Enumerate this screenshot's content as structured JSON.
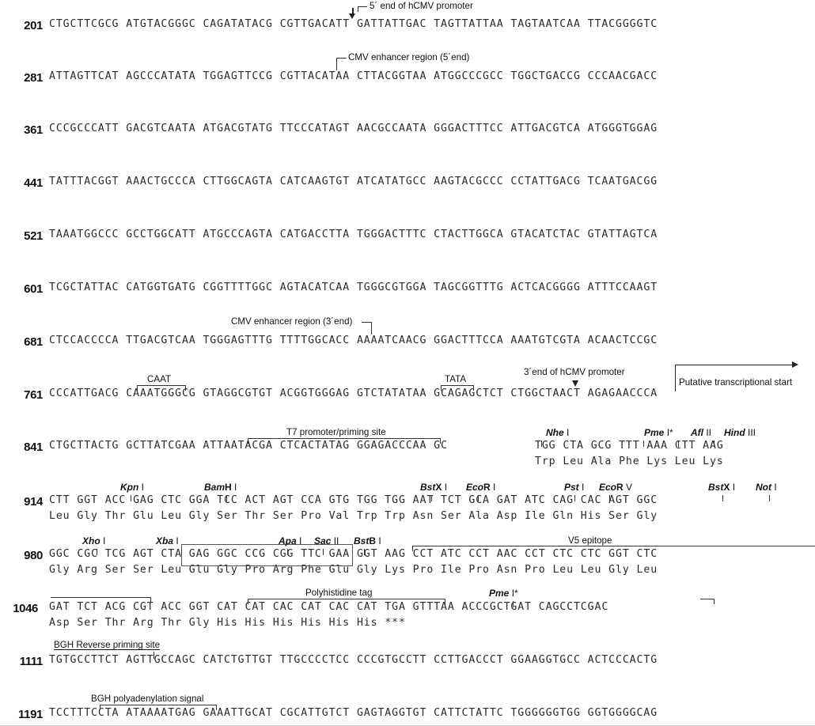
{
  "document": {
    "kind": "plasmid-sequence-map",
    "first_base_shown": 201,
    "bases_per_line": 80,
    "block_size": 10
  },
  "sequence_rows": [
    {
      "number": "201",
      "bases": "CTGCTTCGCG ATGTACGGGC CAGATATACG CGTTGACATT GATTATTGAC TAGTTATTAA TAGTAATCAA TTACGGGGTC"
    },
    {
      "number": "281",
      "bases": "ATTAGTTCAT AGCCCATATA TGGAGTTCCG CGTTACATAA CTTACGGTAA ATGGCCCGCC TGGCTGACCG CCCAACGACC"
    },
    {
      "number": "361",
      "bases": "CCCGCCCATT GACGTCAATA ATGACGTATG TTCCCATAGT AACGCCAATA GGGACTTTCC ATTGACGTCA ATGGGTGGAG"
    },
    {
      "number": "441",
      "bases": "TATTTACGGT AAACTGCCCA CTTGGCAGTA CATCAAGTGT ATCATATGCC AAGTACGCCC CCTATTGACG TCAATGACGG"
    },
    {
      "number": "521",
      "bases": "TAAATGGCCC GCCTGGCATT ATGCCCAGTA CATGACCTTA TGGGACTTTC CTACTTGGCA GTACATCTAC GTATTAGTCA"
    },
    {
      "number": "601",
      "bases": "TCGCTATTAC CATGGTGATG CGGTTTTGGC AGTACATCAA TGGGCGTGGA TAGCGGTTTG ACTCACGGGG ATTTCCAAGT"
    },
    {
      "number": "681",
      "bases": "CTCCACCCCA TTGACGTCAA TGGGAGTTTG TTTTGGCACC AAAATCAACG GGACTTTCCA AAATGTCGTA ACAACTCCGC"
    },
    {
      "number": "761",
      "bases": "CCCATTGACG CAAATGGGCG GTAGGCGTGT ACGGTGGGAG GTCTATATAA GCAGAGCTCT CTGGCTAACT AGAGAACCCA"
    }
  ],
  "codon_rows": [
    {
      "number": "841",
      "plain_prefix": "CTGCTTACTG GCTTATCGAA ATTAATACGA CTCACTATAG GGAGACCCAA GC",
      "codons": [
        "TGG",
        "CTA",
        "GCG",
        "TTT",
        "AAA",
        "CTT",
        "AAG"
      ],
      "amino_acids": [
        "Trp",
        "Leu",
        "Ala",
        "Phe",
        "Lys",
        "Leu",
        "Lys"
      ]
    },
    {
      "number": "914",
      "plain_prefix": "",
      "codons": [
        "CTT",
        "GGT",
        "ACC",
        "GAG",
        "CTC",
        "GGA",
        "TCC",
        "ACT",
        "AGT",
        "CCA",
        "GTG",
        "TGG",
        "TGG",
        "AAT",
        "TCT",
        "GCA",
        "GAT",
        "ATC",
        "CAG",
        "CAC",
        "AGT",
        "GGC"
      ],
      "amino_acids": [
        "Leu",
        "Gly",
        "Thr",
        "Glu",
        "Leu",
        "Gly",
        "Ser",
        "Thr",
        "Ser",
        "Pro",
        "Val",
        "Trp",
        "Trp",
        "Asn",
        "Ser",
        "Ala",
        "Asp",
        "Ile",
        "Gln",
        "His",
        "Ser",
        "Gly"
      ]
    },
    {
      "number": "980",
      "plain_prefix": "",
      "codons": [
        "GGC",
        "CGC",
        "TCG",
        "AGT",
        "CTA",
        "GAG",
        "GGC",
        "CCG",
        "CGG",
        "TTC",
        "GAA",
        "GGT",
        "AAG",
        "CCT",
        "ATC",
        "CCT",
        "AAC",
        "CCT",
        "CTC",
        "CTC",
        "GGT",
        "CTC"
      ],
      "amino_acids": [
        "Gly",
        "Arg",
        "Ser",
        "Ser",
        "Leu",
        "Glu",
        "Gly",
        "Pro",
        "Arg",
        "Phe",
        "Glu",
        "Gly",
        "Lys",
        "Pro",
        "Ile",
        "Pro",
        "Asn",
        "Pro",
        "Leu",
        "Leu",
        "Gly",
        "Leu"
      ]
    },
    {
      "number": "1046",
      "plain_prefix": "",
      "codons": [
        "GAT",
        "TCT",
        "ACG",
        "CGT",
        "ACC",
        "GGT",
        "CAT",
        "CAT",
        "CAC",
        "CAT",
        "CAC",
        "CAT",
        "TGA"
      ],
      "amino_acids": [
        "Asp",
        "Ser",
        "Thr",
        "Arg",
        "Thr",
        "Gly",
        "His",
        "His",
        "His",
        "His",
        "His",
        "His",
        "***"
      ],
      "tail": "GTTTAA ACCCGCTGAT CAGCCTCGAC"
    }
  ],
  "tail_rows": [
    {
      "number": "1111",
      "bases": "TGTGCCTTCT AGTTGCCAGC CATCTGTTGT TTGCCCCTCC CCCGTGCCTT CCTTGACCCT GGAAGGTGCC ACTCCCACTG"
    },
    {
      "number": "1191",
      "bases": "TCCTTTCCTA ATAAAATGAG GAAATTGCAT CGCATTGTCT GAGTAGGTGT CATTCTATTC TGGGGGGTGG GGTGGGGCAG"
    }
  ],
  "feature_labels": {
    "hcmv_5_end": "5´ end of hCMV promoter",
    "cmv_enhancer_5": "CMV enhancer region (5´end)",
    "cmv_enhancer_3": "CMV enhancer region (3´end)",
    "caat": "CAAT",
    "tata": "TATA",
    "hcmv_3_end": "3´end of hCMV promoter",
    "putative_start": "Putative transcriptional start",
    "t7_promoter": "T7 promoter/priming site",
    "v5_epitope": "V5 epitope",
    "polyhistidine": "Polyhistidine tag",
    "bgh_reverse": "BGH Reverse priming site",
    "bgh_polya": "BGH polyadenylation signal"
  },
  "restriction_sites": [
    {
      "id": "nhe1",
      "italic": "Nhe",
      "upright": "",
      "roman": " I"
    },
    {
      "id": "pme1a",
      "italic": "Pme",
      "upright": "",
      "roman": " I*"
    },
    {
      "id": "afl2",
      "italic": "Afl",
      "upright": "",
      "roman": " II"
    },
    {
      "id": "hind3",
      "italic": "Hind",
      "upright": "",
      "roman": " III"
    },
    {
      "id": "kpn1",
      "italic": "Kpn",
      "upright": "",
      "roman": " I"
    },
    {
      "id": "bamh1",
      "italic": "Bam",
      "upright": "H",
      "roman": " I"
    },
    {
      "id": "bstx1a",
      "italic": "Bst",
      "upright": "X",
      "roman": " I"
    },
    {
      "id": "ecor1",
      "italic": "Eco",
      "upright": "R",
      "roman": " I"
    },
    {
      "id": "pst1",
      "italic": "Pst",
      "upright": "",
      "roman": " I"
    },
    {
      "id": "ecorv",
      "italic": "Eco",
      "upright": "R",
      "roman": " V"
    },
    {
      "id": "bstx1b",
      "italic": "Bst",
      "upright": "X",
      "roman": " I"
    },
    {
      "id": "not1",
      "italic": "Not",
      "upright": "",
      "roman": " I"
    },
    {
      "id": "xho1",
      "italic": "Xho",
      "upright": "",
      "roman": " I"
    },
    {
      "id": "xba1",
      "italic": "Xba",
      "upright": "",
      "roman": " I"
    },
    {
      "id": "apa1",
      "italic": "Apa",
      "upright": "",
      "roman": " I"
    },
    {
      "id": "sac2",
      "italic": "Sac",
      "upright": "",
      "roman": " II"
    },
    {
      "id": "bstb1",
      "italic": "Bst",
      "upright": "B",
      "roman": " I"
    },
    {
      "id": "pme1b",
      "italic": "Pme",
      "upright": "",
      "roman": " I*"
    }
  ],
  "colors": {
    "text": "#1b1b1b",
    "sequence": "#2a2a2a",
    "rule": "#333333",
    "page": "#ffffff"
  }
}
